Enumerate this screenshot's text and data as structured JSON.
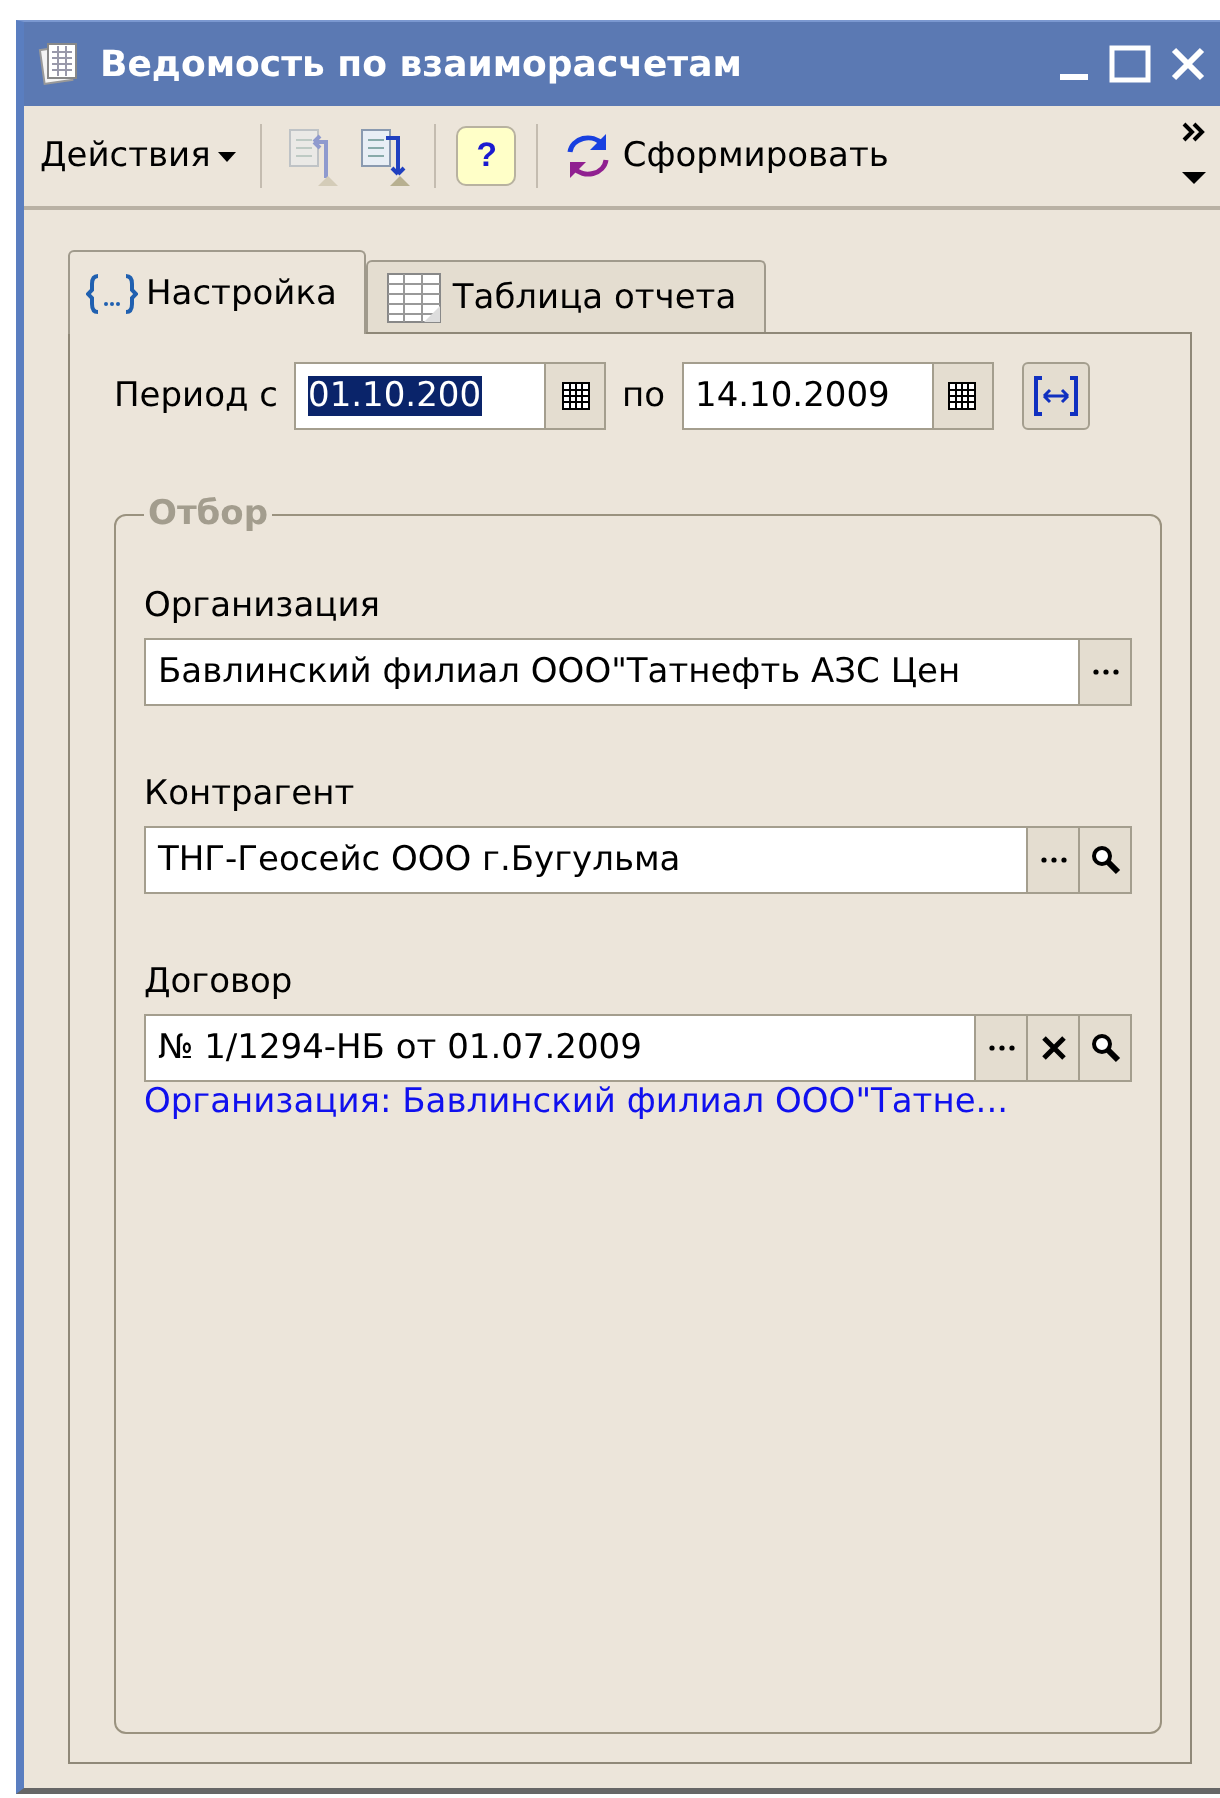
{
  "window": {
    "title": "Ведомость по взаиморасчетам"
  },
  "toolbar": {
    "items": [
      {
        "kind": "menu",
        "label": "Действия",
        "disabled": false
      },
      {
        "kind": "icon",
        "disabled": true
      },
      {
        "kind": "icon",
        "disabled": false
      },
      {
        "kind": "help",
        "label": "?",
        "disabled": false
      },
      {
        "kind": "action",
        "label": "Сформировать",
        "disabled": false
      }
    ]
  },
  "tabs": [
    {
      "label": "Настройка",
      "selected": true
    },
    {
      "label": "Таблица отчета",
      "selected": false
    }
  ],
  "period": {
    "label": "Период с",
    "from": {
      "value": "01.10.200",
      "text_selected": true
    },
    "to_label": "по",
    "to": {
      "value": "14.10.2009",
      "text_selected": false
    }
  },
  "filter": {
    "title": "Отбор",
    "disabled": true,
    "fields": [
      {
        "label": "Организация",
        "value": "Бавлинский филиал ООО\"Татнефть АЗС Цен",
        "buttons": [
          {
            "kind": "choose"
          }
        ]
      },
      {
        "label": "Контрагент",
        "value": "ТНГ-Геосейс ООО г.Бугульма",
        "buttons": [
          {
            "kind": "choose"
          },
          {
            "kind": "open"
          }
        ]
      },
      {
        "label": "Договор",
        "value": "№ 1/1294-НБ от 01.07.2009",
        "buttons": [
          {
            "kind": "choose"
          },
          {
            "kind": "clear"
          },
          {
            "kind": "open"
          }
        ]
      }
    ],
    "link": "Организация: Бавлинский филиал ООО\"Татне..."
  }
}
